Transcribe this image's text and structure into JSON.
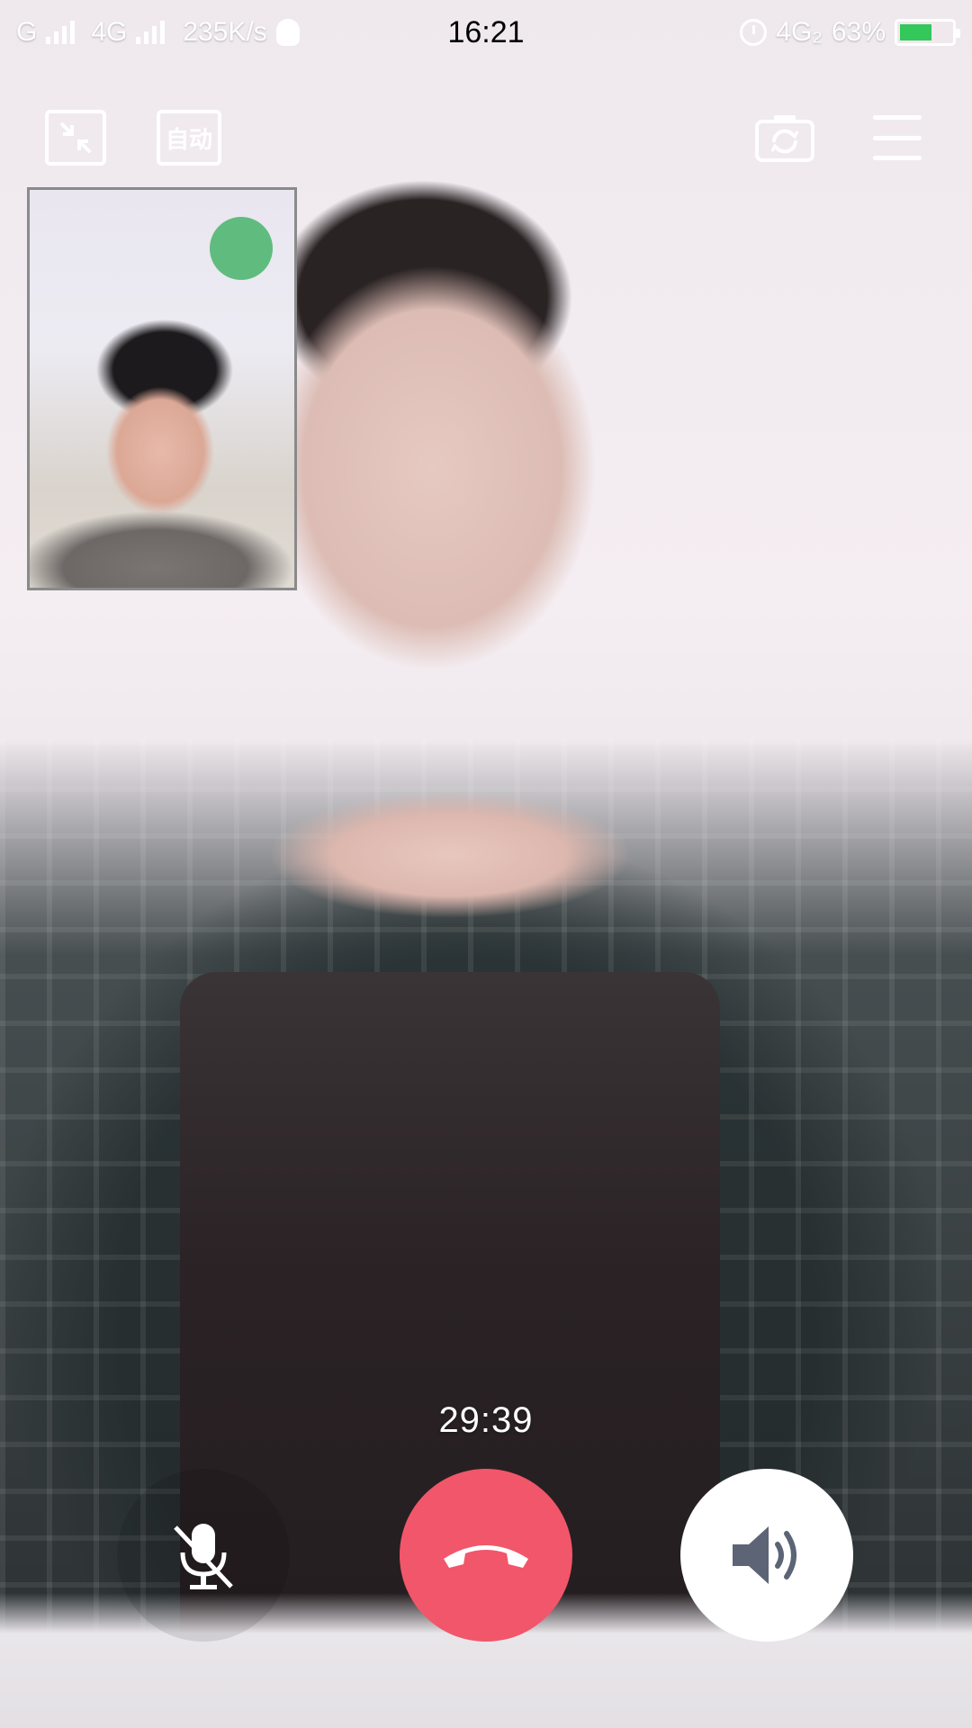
{
  "status_bar": {
    "carrier1": "G",
    "carrier2": "4G",
    "net_speed": "235K/s",
    "time": "16:21",
    "network_right": "4G₂",
    "battery_percent": "63%",
    "battery_level": 0.63,
    "battery_color": "#34c759"
  },
  "top_controls": {
    "minimize_icon": "minimize-arrows-icon",
    "auto_label": "自动",
    "camera_switch_icon": "camera-switch-icon",
    "menu_icon": "hamburger-menu-icon"
  },
  "call": {
    "duration": "29:39",
    "mute_icon": "microphone-muted-icon",
    "hangup_icon": "phone-hangup-icon",
    "hangup_color": "#f2566a",
    "speaker_icon": "speaker-icon"
  }
}
